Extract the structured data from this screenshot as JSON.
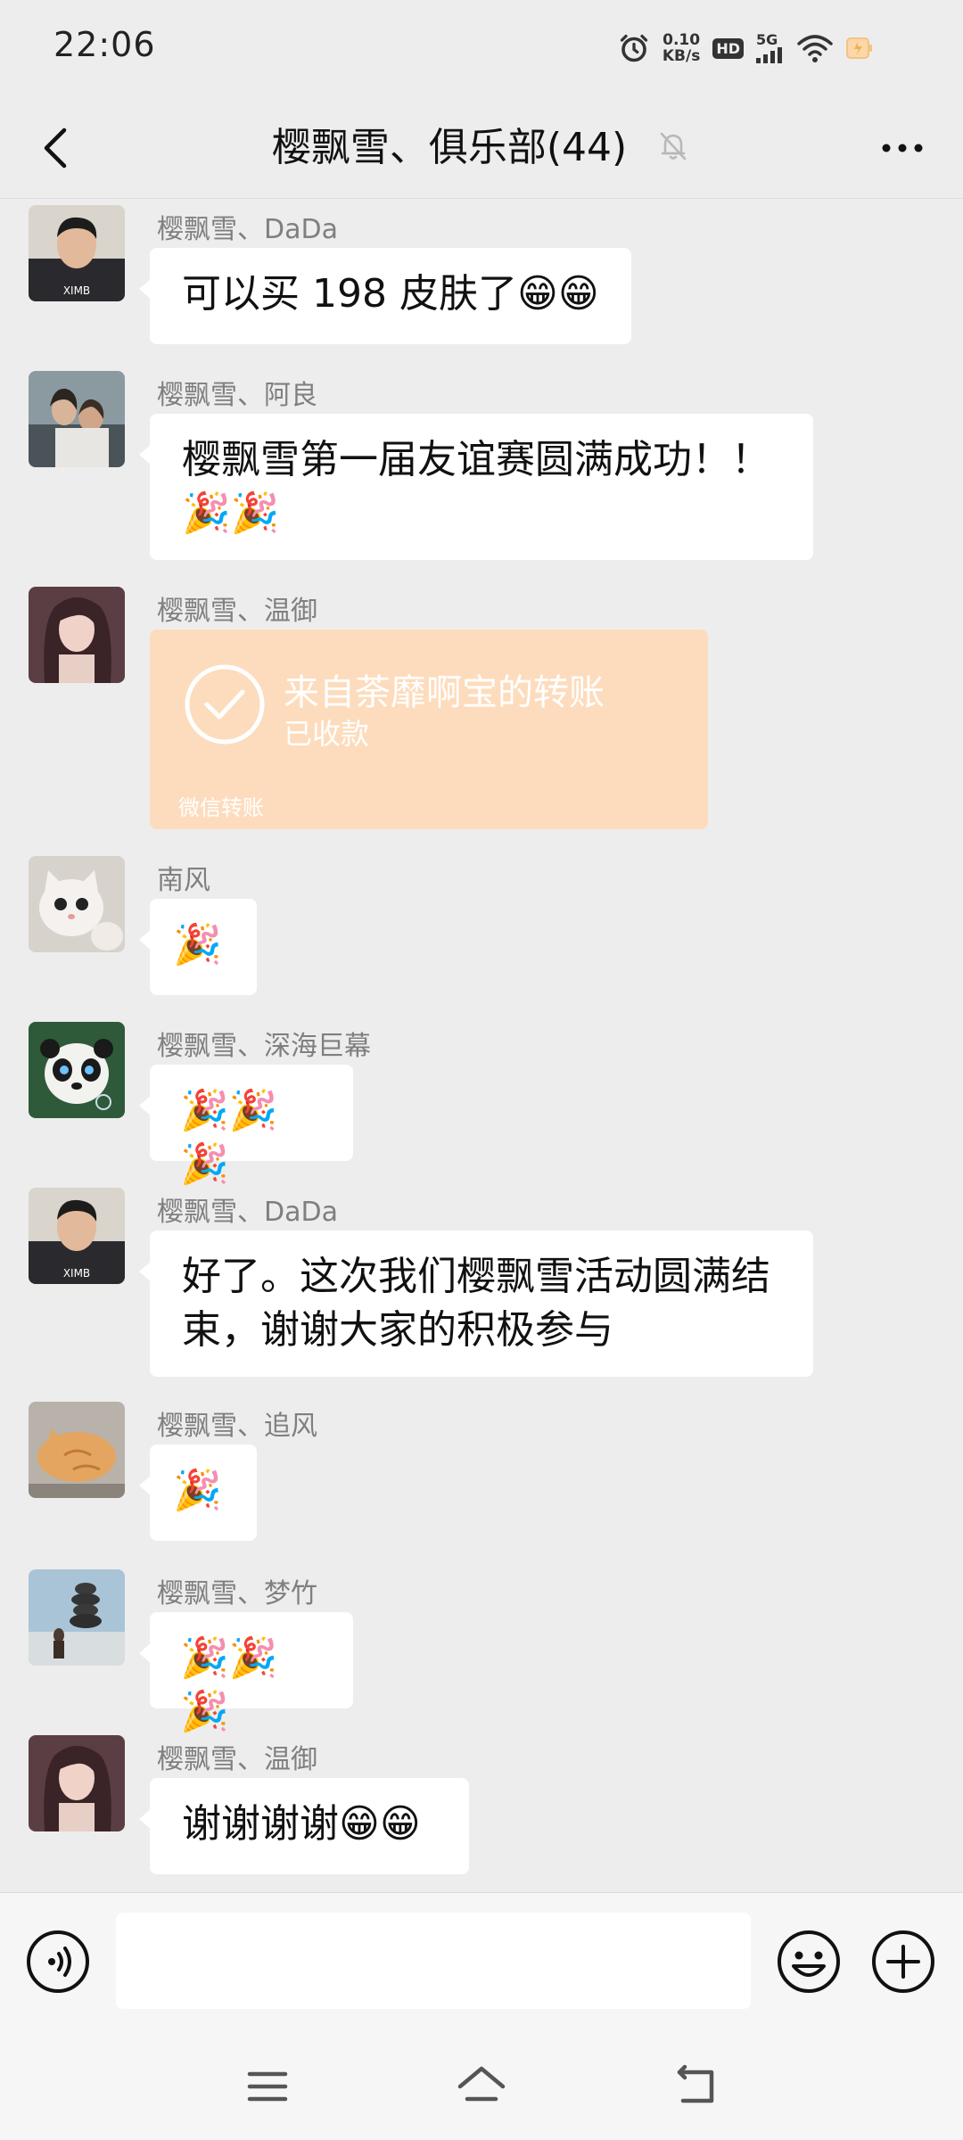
{
  "status_bar": {
    "time": "22:06",
    "net_speed_value": "0.10",
    "net_speed_unit": "KB/s",
    "hd_badge": "HD",
    "signal_label": "5G"
  },
  "header": {
    "title": "樱飘雪、俱乐部(44)"
  },
  "messages": [
    {
      "sender": "樱飘雪、DaDa",
      "text": "可以买 198 皮肤了😁😁",
      "avatar": "man-avatar"
    },
    {
      "sender": "樱飘雪、阿良",
      "text": "樱飘雪第一届友谊赛圆满成功！！🎉🎉",
      "avatar": "couple-avatar"
    },
    {
      "sender": "樱飘雪、温御",
      "avatar": "woman-avatar",
      "transfer": {
        "title": "来自荼靡啊宝的转账",
        "status": "已收款",
        "footer": "微信转账"
      }
    },
    {
      "sender": "南风",
      "text": "🎉",
      "avatar": "cat-avatar"
    },
    {
      "sender": "樱飘雪、深海巨幕",
      "text": "🎉🎉🎉",
      "avatar": "panda-avatar"
    },
    {
      "sender": "樱飘雪、DaDa",
      "text": "好了。这次我们樱飘雪活动圆满结束，谢谢大家的积极参与",
      "avatar": "man-avatar"
    },
    {
      "sender": "樱飘雪、追风",
      "text": "🎉",
      "avatar": "orange-cat-avatar"
    },
    {
      "sender": "樱飘雪、梦竹",
      "text": "🎉🎉🎉",
      "avatar": "stones-avatar"
    },
    {
      "sender": "樱飘雪、温御",
      "text": "谢谢谢谢😁😁",
      "avatar": "woman-avatar"
    }
  ],
  "input": {
    "placeholder": ""
  },
  "colors": {
    "background": "#ededed",
    "bubble": "#ffffff",
    "transfer_card": "#fddcbd",
    "sender_text": "#7f7f7f"
  }
}
